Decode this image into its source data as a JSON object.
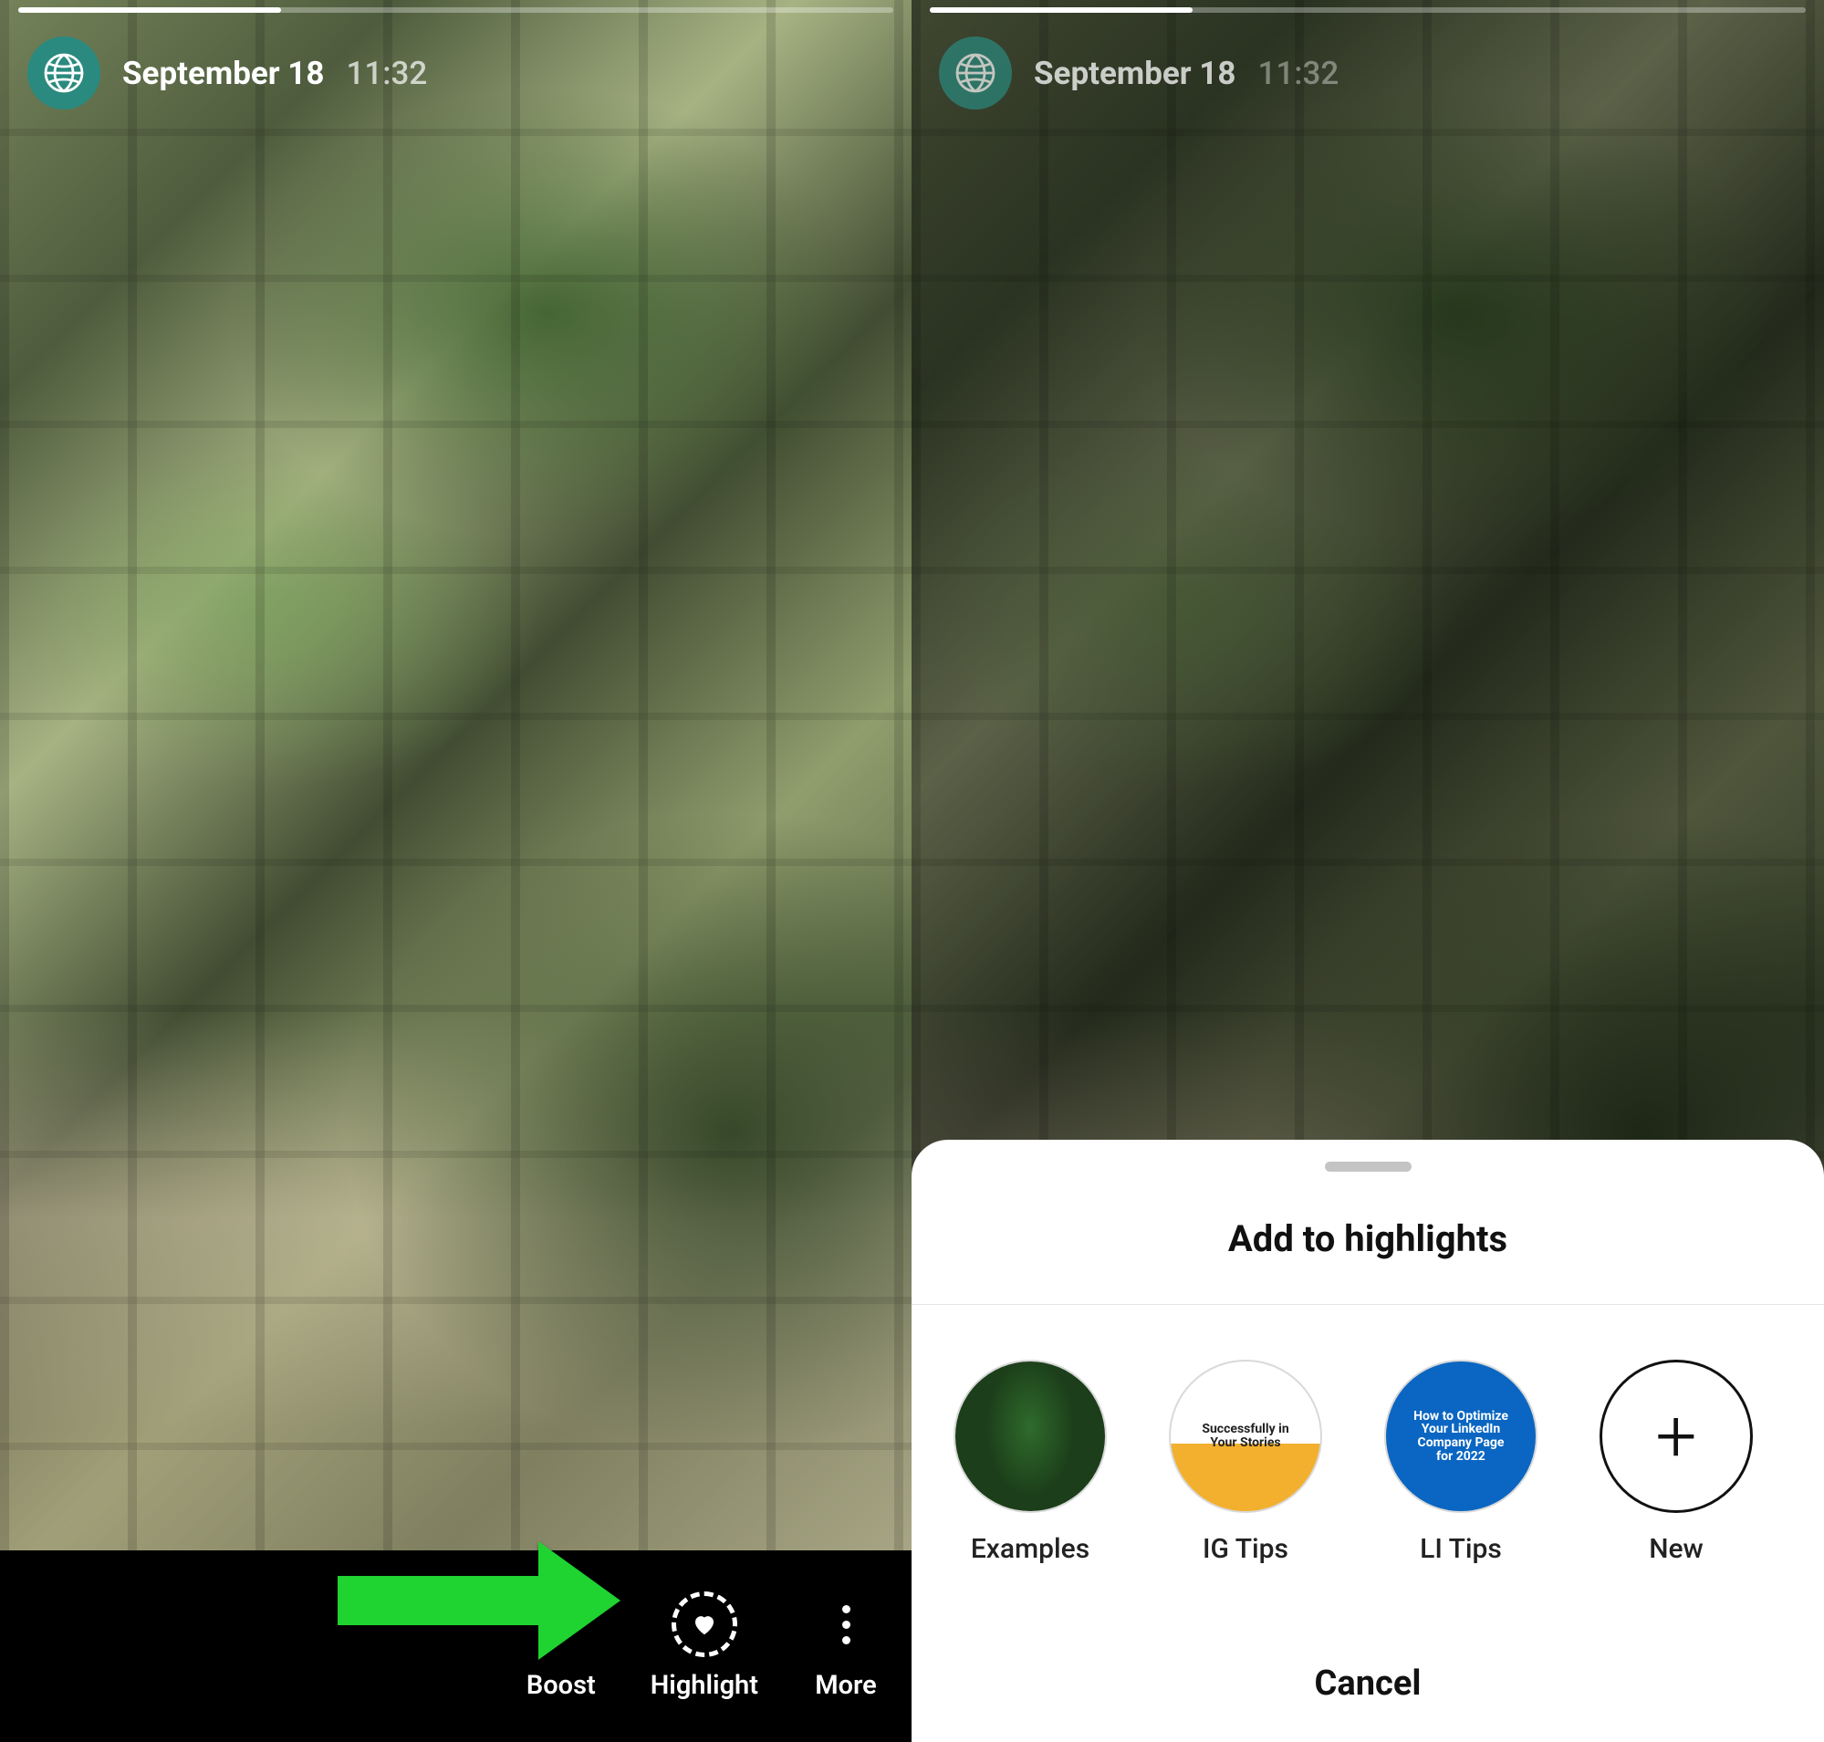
{
  "story": {
    "date": "September 18",
    "time": "11:32"
  },
  "leftActions": {
    "boost": "Boost",
    "highlight": "Highlight",
    "more": "More"
  },
  "sheet": {
    "title": "Add to highlights",
    "cancel": "Cancel",
    "items": [
      {
        "label": "Examples"
      },
      {
        "label": "IG Tips"
      },
      {
        "label": "LI Tips"
      }
    ],
    "newLabel": "New"
  }
}
